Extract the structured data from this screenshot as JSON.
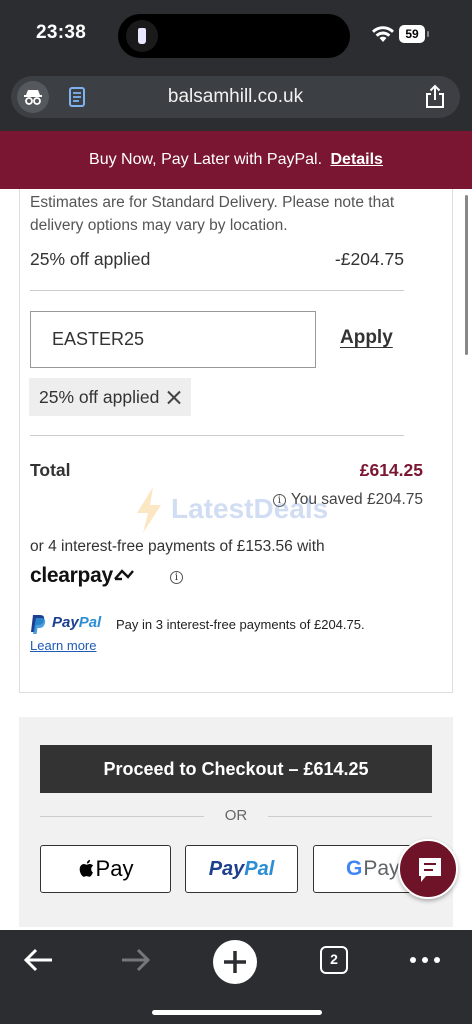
{
  "status_bar": {
    "time": "23:38",
    "battery": "59"
  },
  "browser": {
    "domain": "balsamhill.co.uk",
    "tab_count": "2"
  },
  "banner": {
    "text": "Buy Now, Pay Later with PayPal.",
    "link": "Details"
  },
  "summary": {
    "delivery_note": "Estimates are for Standard Delivery. Please note that delivery options may vary by location.",
    "discount_label": "25% off applied",
    "discount_amount": "-£204.75",
    "promo_code_value": "EASTER25",
    "apply_label": "Apply",
    "applied_chip": "25% off applied",
    "total_label": "Total",
    "total_amount": "£614.25",
    "saved_text": "You saved £204.75",
    "watermark": "LatestDeals",
    "clearpay_text": "or 4 interest-free payments of £153.56 with",
    "clearpay_logo": "clearpay",
    "paypal_brand_a": "Pay",
    "paypal_brand_b": "Pal",
    "paypal_text": "Pay in 3 interest-free payments of £204.75.",
    "paypal_learn_more": "Learn more"
  },
  "checkout": {
    "button_label": "Proceed to Checkout – £614.25",
    "or_label": "OR",
    "apple_pay_label": "Pay",
    "paypal_a": "Pay",
    "paypal_b": "Pal",
    "google_g": "G",
    "google_pay": "Pay"
  },
  "colors": {
    "brand": "#7a1631",
    "checkout_button": "#333333",
    "paypal_dark": "#1d3f8f",
    "paypal_light": "#2c8fd6"
  }
}
